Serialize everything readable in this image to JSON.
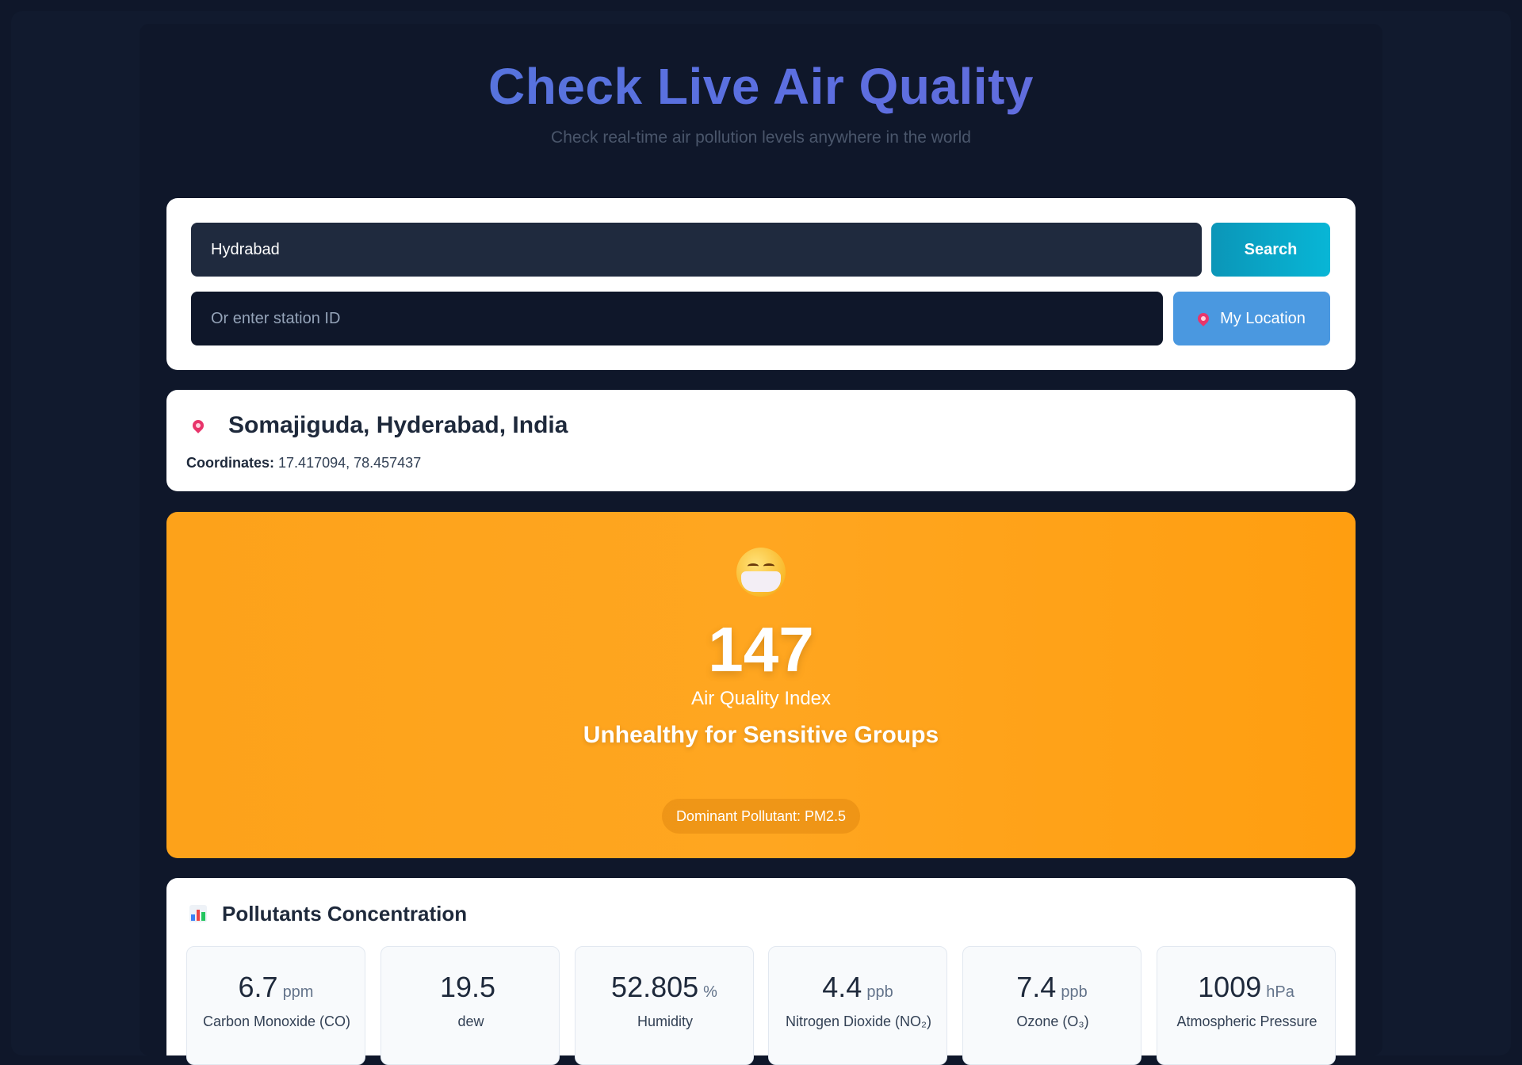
{
  "header": {
    "title": "Check Live Air Quality",
    "subtitle": "Check real-time air pollution levels anywhere in the world"
  },
  "search": {
    "city_value": "Hydrabad",
    "station_placeholder": "Or enter station ID",
    "search_label": "Search",
    "location_label": "My Location"
  },
  "location": {
    "name": "Somajiguda, Hyderabad, India",
    "coords_label": "Coordinates:",
    "coords_value": "17.417094, 78.457437"
  },
  "aqi": {
    "value": "147",
    "label": "Air Quality Index",
    "status": "Unhealthy for Sensitive Groups",
    "dominant": "Dominant Pollutant: PM2.5",
    "color": "#ffa31a"
  },
  "pollutants": {
    "title": "Pollutants Concentration",
    "items": [
      {
        "value": "6.7",
        "unit": "ppm",
        "name": "Carbon Monoxide (CO)"
      },
      {
        "value": "19.5",
        "unit": "",
        "name": "dew"
      },
      {
        "value": "52.805",
        "unit": "%",
        "name": "Humidity"
      },
      {
        "value": "4.4",
        "unit": "ppb",
        "name": "Nitrogen Dioxide (NO₂)"
      },
      {
        "value": "7.4",
        "unit": "ppb",
        "name": "Ozone (O₃)"
      },
      {
        "value": "1009",
        "unit": "hPa",
        "name": "Atmospheric Pressure"
      }
    ]
  }
}
